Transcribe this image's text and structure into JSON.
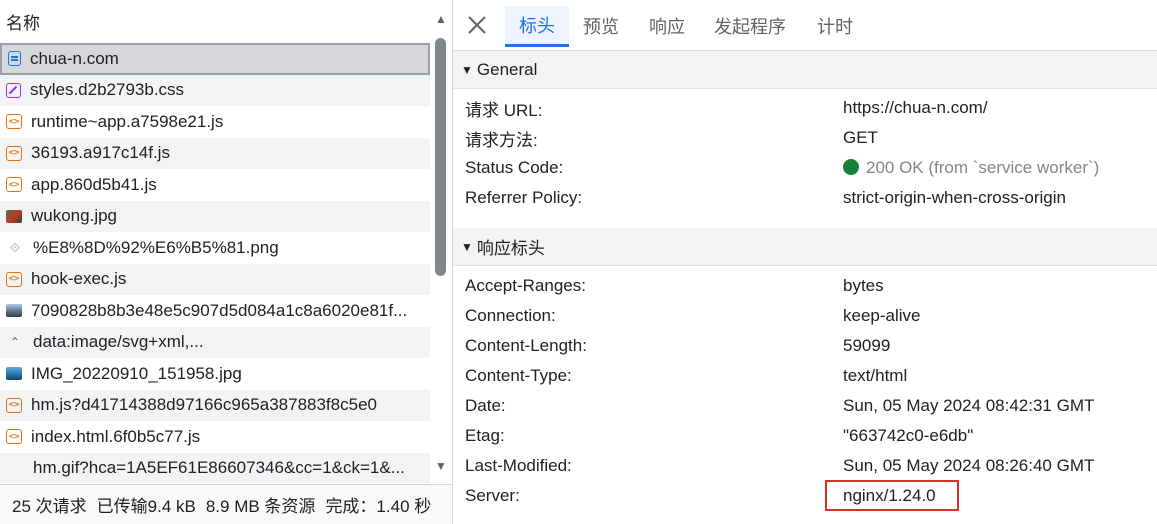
{
  "left": {
    "header": "名称",
    "rows": [
      {
        "name": "chua-n.com",
        "icon": "document-icon"
      },
      {
        "name": "styles.d2b2793b.css",
        "icon": "stylesheet-icon"
      },
      {
        "name": "runtime~app.a7598e21.js",
        "icon": "script-icon"
      },
      {
        "name": "36193.a917c14f.js",
        "icon": "script-icon"
      },
      {
        "name": "app.860d5b41.js",
        "icon": "script-icon"
      },
      {
        "name": "wukong.jpg",
        "icon": "image-icon"
      },
      {
        "name": "%E8%8D%92%E6%B5%81.png",
        "icon": "png-icon"
      },
      {
        "name": "hook-exec.js",
        "icon": "script-icon"
      },
      {
        "name": "7090828b8b3e48e5c907d5d084a1c8a6020e81f...",
        "icon": "image-icon"
      },
      {
        "name": "data:image/svg+xml,...",
        "icon": "svg-icon"
      },
      {
        "name": "IMG_20220910_151958.jpg",
        "icon": "image-icon"
      },
      {
        "name": "hm.js?d41714388d97166c965a387883f8c5e0",
        "icon": "script-icon"
      },
      {
        "name": "index.html.6f0b5c77.js",
        "icon": "script-icon"
      },
      {
        "name": "hm.gif?hca=1A5EF61E86607346&cc=1&ck=1&...",
        "icon": "none"
      }
    ],
    "status": {
      "requests": "25 次请求",
      "transferred": "已传输9.4 kB",
      "resources": "8.9 MB 条资源",
      "finish": "完成：1.40 秒"
    }
  },
  "right": {
    "tabs": [
      "标头",
      "预览",
      "响应",
      "发起程序",
      "计时"
    ],
    "active_tab": "标头",
    "general": {
      "title": "General",
      "rows": [
        {
          "key": "请求 URL:",
          "value": "https://chua-n.com/"
        },
        {
          "key": "请求方法:",
          "value": "GET"
        },
        {
          "key": "Status Code:",
          "value": "200 OK (from `service worker`)"
        },
        {
          "key": "Referrer Policy:",
          "value": "strict-origin-when-cross-origin"
        }
      ]
    },
    "response_headers": {
      "title": "响应标头",
      "rows": [
        {
          "key": "Accept-Ranges:",
          "value": "bytes"
        },
        {
          "key": "Connection:",
          "value": "keep-alive"
        },
        {
          "key": "Content-Length:",
          "value": "59099"
        },
        {
          "key": "Content-Type:",
          "value": "text/html"
        },
        {
          "key": "Date:",
          "value": "Sun, 05 May 2024 08:42:31 GMT"
        },
        {
          "key": "Etag:",
          "value": "\"663742c0-e6db\""
        },
        {
          "key": "Last-Modified:",
          "value": "Sun, 05 May 2024 08:26:40 GMT"
        },
        {
          "key": "Server:",
          "value": "nginx/1.24.0"
        }
      ]
    }
  },
  "colors": {
    "accent": "#1a73e8",
    "status_ok": "#188038",
    "highlight": "#d93025"
  }
}
